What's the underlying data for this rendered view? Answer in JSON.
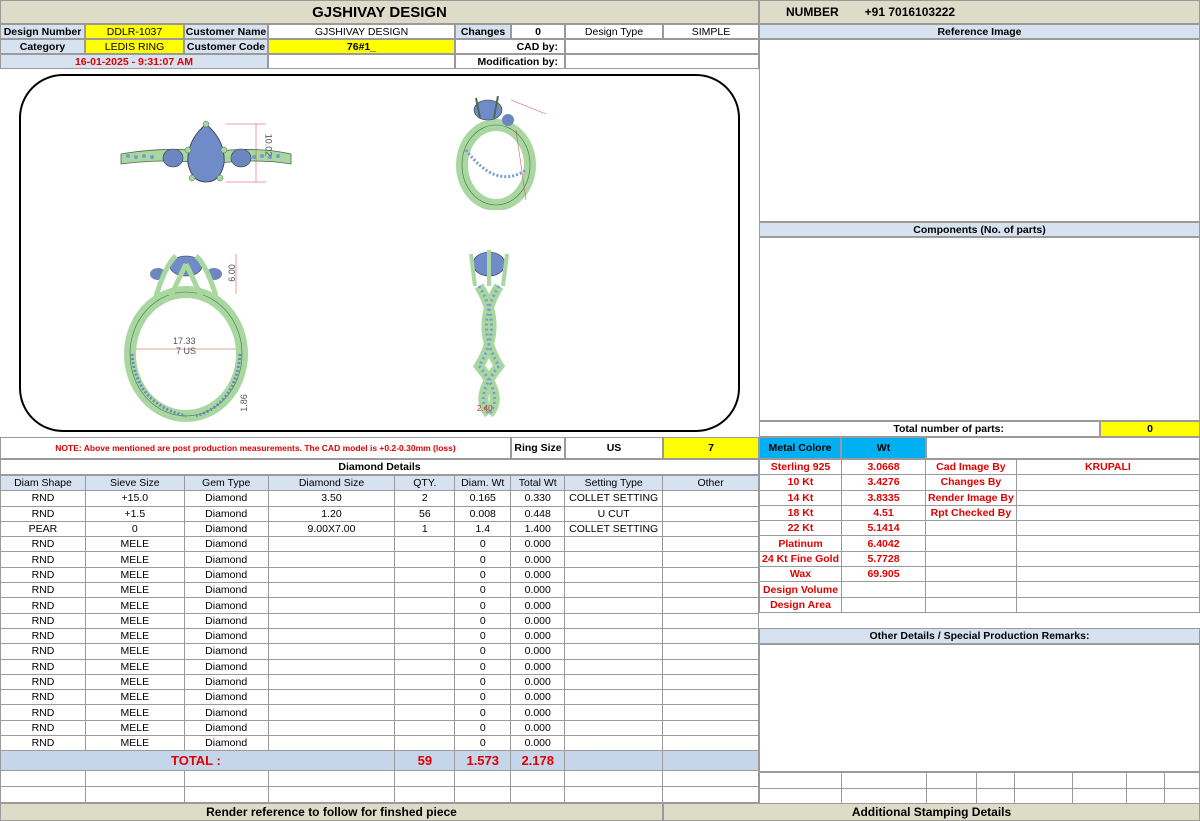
{
  "header": {
    "title": "GJSHIVAY DESIGN",
    "number_label": "NUMBER",
    "phone": "+91 7016103222"
  },
  "info": {
    "design_number_label": "Design Number",
    "design_number": "DDLR-1037",
    "customer_name_label": "Customer Name",
    "customer_name": "GJSHIVAY DESIGN",
    "changes_label": "Changes",
    "changes": "0",
    "design_type_label": "Design Type",
    "design_type": "SIMPLE",
    "category_label": "Category",
    "category": "LEDIS RING",
    "customer_code_label": "Customer Code",
    "customer_code": "76#1_",
    "cad_by_label": "CAD by:",
    "timestamp": "16-01-2025 - 9:31:07 AM",
    "modification_label": "Modification by:"
  },
  "renders": {
    "dim1": "10.02",
    "dim2": "6.00",
    "dim3": "17.33",
    "dim4": "7 US",
    "dim5": "1.86",
    "dim6": "2.40"
  },
  "note": {
    "text": "NOTE: Above mentioned are post production measurements. The CAD model is +0.2-0.30mm (loss)",
    "ring_size_label": "Ring Size",
    "ring_size_system": "US",
    "ring_size": "7"
  },
  "right": {
    "reference_image": "Reference Image",
    "components": "Components (No. of parts)",
    "total_parts_label": "Total number of parts:",
    "total_parts": "0",
    "metal_colore": "Metal Colore",
    "wt": "Wt",
    "other_details": "Other Details / Special Production Remarks:",
    "additional_stamping": "Additional Stamping Details"
  },
  "metals": [
    {
      "name": "Sterling 925",
      "wt": "3.0668",
      "label": "Cad Image By",
      "value": "KRUPALI"
    },
    {
      "name": "10 Kt",
      "wt": "3.4276",
      "label": "Changes By",
      "value": ""
    },
    {
      "name": "14 Kt",
      "wt": "3.8335",
      "label": "Render Image By",
      "value": ""
    },
    {
      "name": "18 Kt",
      "wt": "4.51",
      "label": "Rpt Checked By",
      "value": ""
    },
    {
      "name": "22 Kt",
      "wt": "5.1414",
      "label": "",
      "value": ""
    },
    {
      "name": "Platinum",
      "wt": "6.4042",
      "label": "",
      "value": ""
    },
    {
      "name": "24 Kt Fine Gold",
      "wt": "5.7728",
      "label": "",
      "value": ""
    },
    {
      "name": "Wax",
      "wt": "69.905",
      "label": "",
      "value": ""
    },
    {
      "name": "Design Volume",
      "wt": "",
      "label": "",
      "value": ""
    },
    {
      "name": "Design Area",
      "wt": "",
      "label": "",
      "value": ""
    }
  ],
  "diamond": {
    "title": "Diamond Details",
    "columns": [
      "Diam Shape",
      "Sieve Size",
      "Gem Type",
      "Diamond Size",
      "QTY.",
      "Diam. Wt",
      "Total Wt",
      "Setting Type",
      "Other"
    ],
    "rows": [
      [
        "RND",
        "+15.0",
        "Diamond",
        "3.50",
        "2",
        "0.165",
        "0.330",
        "COLLET SETTING",
        ""
      ],
      [
        "RND",
        "+1.5",
        "Diamond",
        "1.20",
        "56",
        "0.008",
        "0.448",
        "U CUT",
        ""
      ],
      [
        "PEAR",
        "0",
        "Diamond",
        "9.00X7.00",
        "1",
        "1.4",
        "1.400",
        "COLLET SETTING",
        ""
      ],
      [
        "RND",
        "MELE",
        "Diamond",
        "",
        "",
        "0",
        "0.000",
        "",
        ""
      ],
      [
        "RND",
        "MELE",
        "Diamond",
        "",
        "",
        "0",
        "0.000",
        "",
        ""
      ],
      [
        "RND",
        "MELE",
        "Diamond",
        "",
        "",
        "0",
        "0.000",
        "",
        ""
      ],
      [
        "RND",
        "MELE",
        "Diamond",
        "",
        "",
        "0",
        "0.000",
        "",
        ""
      ],
      [
        "RND",
        "MELE",
        "Diamond",
        "",
        "",
        "0",
        "0.000",
        "",
        ""
      ],
      [
        "RND",
        "MELE",
        "Diamond",
        "",
        "",
        "0",
        "0.000",
        "",
        ""
      ],
      [
        "RND",
        "MELE",
        "Diamond",
        "",
        "",
        "0",
        "0.000",
        "",
        ""
      ],
      [
        "RND",
        "MELE",
        "Diamond",
        "",
        "",
        "0",
        "0.000",
        "",
        ""
      ],
      [
        "RND",
        "MELE",
        "Diamond",
        "",
        "",
        "0",
        "0.000",
        "",
        ""
      ],
      [
        "RND",
        "MELE",
        "Diamond",
        "",
        "",
        "0",
        "0.000",
        "",
        ""
      ],
      [
        "RND",
        "MELE",
        "Diamond",
        "",
        "",
        "0",
        "0.000",
        "",
        ""
      ],
      [
        "RND",
        "MELE",
        "Diamond",
        "",
        "",
        "0",
        "0.000",
        "",
        ""
      ],
      [
        "RND",
        "MELE",
        "Diamond",
        "",
        "",
        "0",
        "0.000",
        "",
        ""
      ],
      [
        "RND",
        "MELE",
        "Diamond",
        "",
        "",
        "0",
        "0.000",
        "",
        ""
      ]
    ],
    "total_label": "TOTAL :",
    "total_qty": "59",
    "total_diam_wt": "1.573",
    "total_wt": "2.178"
  },
  "footer": {
    "render_reference": "Render reference to follow for finshed piece"
  }
}
